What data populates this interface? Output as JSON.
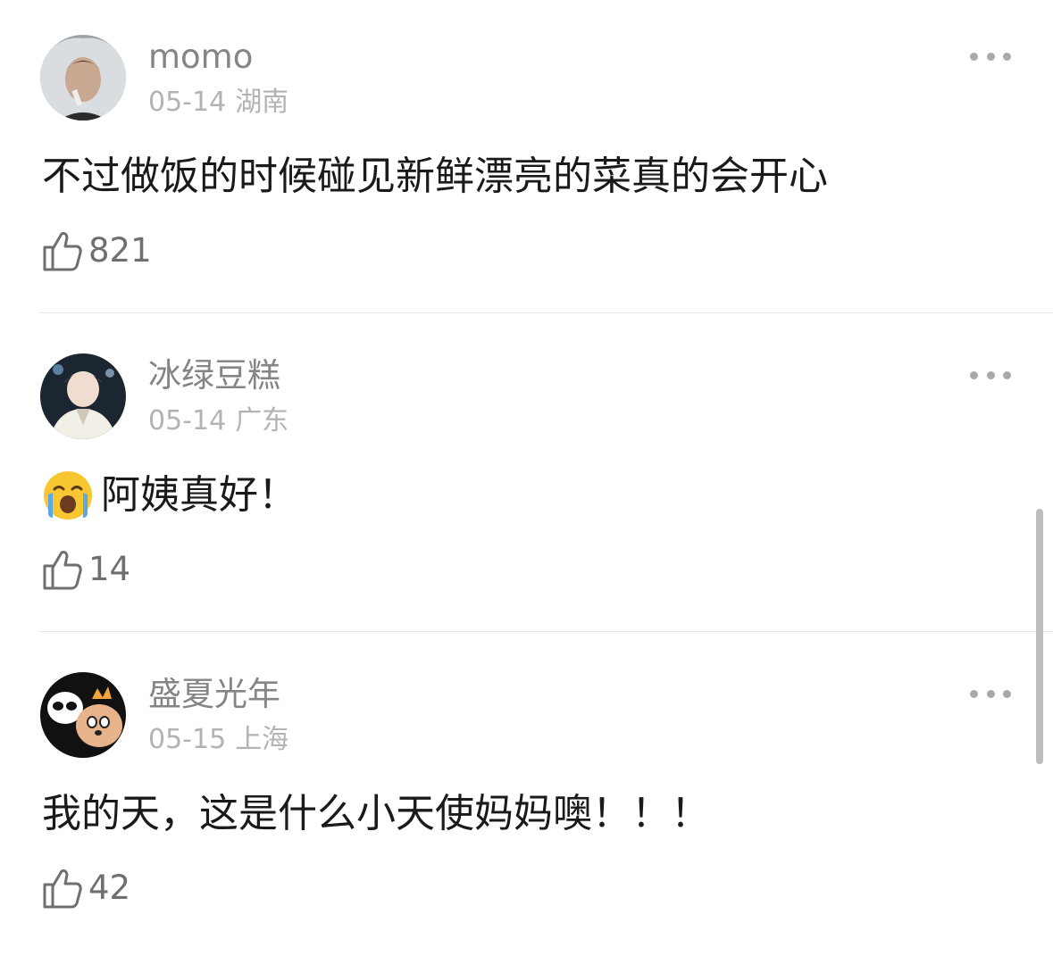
{
  "comments": [
    {
      "username": "momo",
      "date": "05-14",
      "location": "湖南",
      "text": "不过做饭的时候碰见新鲜漂亮的菜真的会开心",
      "likes": "821",
      "avatar_icon": "avatar-photo-veil"
    },
    {
      "username": "冰绿豆糕",
      "date": "05-14",
      "location": "广东",
      "emoji": "loudly-crying-face-emoji",
      "text": "阿姨真好！",
      "likes": "14",
      "avatar_icon": "avatar-photo-performer"
    },
    {
      "username": "盛夏光年",
      "date": "05-15",
      "location": "上海",
      "text": "我的天，这是什么小天使妈妈噢！！！",
      "likes": "42",
      "avatar_icon": "avatar-cartoon-panda-dog"
    }
  ],
  "icons": {
    "more": "more-dots-icon",
    "like": "thumbs-up-outline-icon"
  },
  "colors": {
    "username": "#858585",
    "meta": "#b3b3b3",
    "body": "#1a1a1a",
    "like": "#6f6f6f",
    "divider": "#e6e6e6"
  }
}
